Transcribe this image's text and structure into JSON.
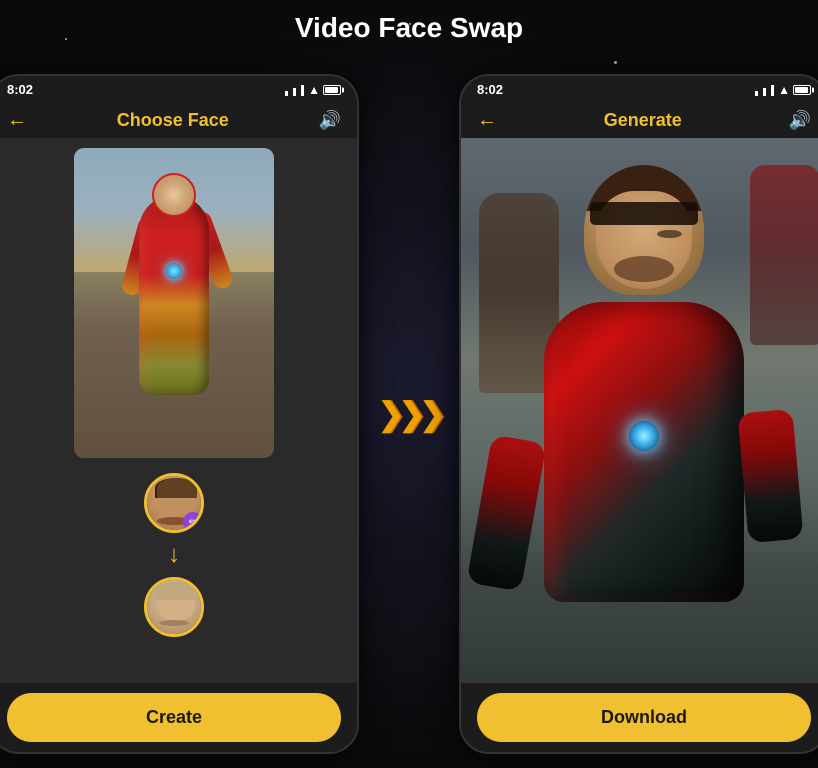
{
  "page": {
    "title": "Video Face Swap",
    "background": "#0a0a0a"
  },
  "left_phone": {
    "status_bar": {
      "time": "8:02"
    },
    "nav": {
      "back_label": "←",
      "title": "Choose Face",
      "sound_label": "🔊"
    },
    "button": {
      "label": "Create"
    }
  },
  "right_phone": {
    "status_bar": {
      "time": "8:02"
    },
    "nav": {
      "back_label": "←",
      "title": "Generate",
      "sound_label": "🔊"
    },
    "button": {
      "label": "Download"
    }
  },
  "arrows": {
    "label": "❯❯❯"
  }
}
